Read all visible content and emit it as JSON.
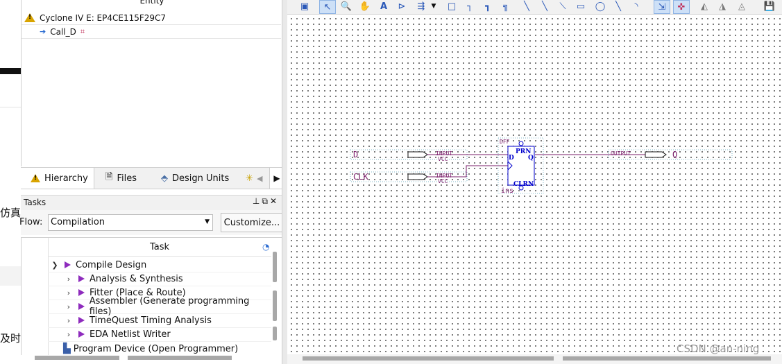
{
  "left_strip": {
    "text1": "仿真",
    "text2": "及时"
  },
  "entity_panel": {
    "header": "Entity",
    "device": "Cyclone IV E: EP4CE115F29C7",
    "top_entity": "Call_D"
  },
  "tabs": [
    {
      "label": "Hierarchy",
      "icon": "warning-icon"
    },
    {
      "label": "Files",
      "icon": "file-icon"
    },
    {
      "label": "Design Units",
      "icon": "units-icon"
    }
  ],
  "tasks": {
    "title": "Tasks",
    "flow_label": "Flow:",
    "flow_value": "Compilation",
    "customize_label": "Customize...",
    "column_header": "Task",
    "items": [
      {
        "label": "Compile Design",
        "expanded": true,
        "level": 0
      },
      {
        "label": "Analysis & Synthesis",
        "expanded": false,
        "level": 1
      },
      {
        "label": "Fitter (Place & Route)",
        "expanded": false,
        "level": 1
      },
      {
        "label": "Assembler (Generate programming files)",
        "expanded": false,
        "level": 1
      },
      {
        "label": "TimeQuest Timing Analysis",
        "expanded": false,
        "level": 1
      },
      {
        "label": "EDA Netlist Writer",
        "expanded": false,
        "level": 1
      },
      {
        "label": "Program Device (Open Programmer)",
        "level": 0
      }
    ]
  },
  "schematic": {
    "pin_d": "D",
    "pin_clk": "CLK",
    "input_label": "INPUT",
    "vcc_label": "VCC",
    "output_label": "OUTPUT",
    "pin_q": "Q",
    "dff_name": "DFF",
    "dff_prn": "PRN",
    "dff_d": "D",
    "dff_q": "Q",
    "dff_clrn": "CLRN",
    "inst_label": "ins"
  },
  "watermark": "CSDN @an-ning",
  "colors": {
    "wire": "#7a1c6a",
    "component": "#0000cc",
    "warning": "#d9a400",
    "task_arrow": "#8e2bbd"
  }
}
